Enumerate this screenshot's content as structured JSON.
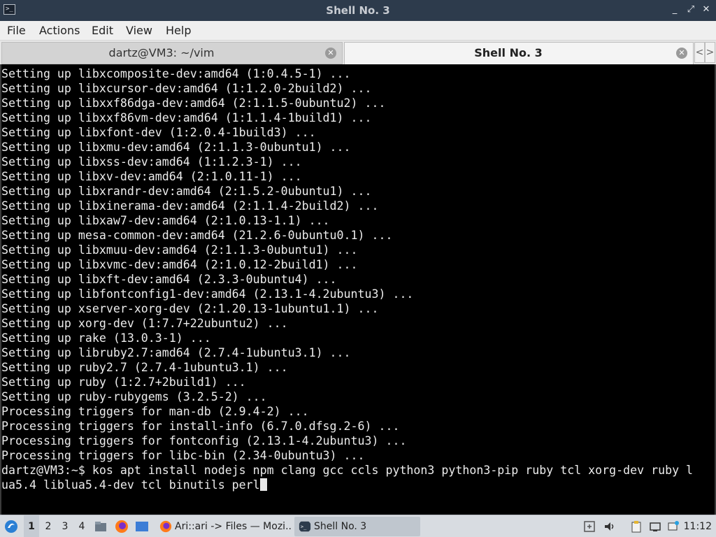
{
  "window": {
    "title": "Shell No. 3",
    "buttons": [
      "_",
      "⤢",
      "✕"
    ]
  },
  "menu": [
    "File",
    "Actions",
    "Edit",
    "View",
    "Help"
  ],
  "tabs": [
    {
      "label": "dartz@VM3: ~/vim",
      "active": false
    },
    {
      "label": "Shell No. 3",
      "active": true
    }
  ],
  "tab_nav": {
    "prev": "<",
    "next": ">"
  },
  "terminal": {
    "lines": [
      "Setting up libxcomposite-dev:amd64 (1:0.4.5-1) ...",
      "Setting up libxcursor-dev:amd64 (1:1.2.0-2build2) ...",
      "Setting up libxxf86dga-dev:amd64 (2:1.1.5-0ubuntu2) ...",
      "Setting up libxxf86vm-dev:amd64 (1:1.1.4-1build1) ...",
      "Setting up libxfont-dev (1:2.0.4-1build3) ...",
      "Setting up libxmu-dev:amd64 (2:1.1.3-0ubuntu1) ...",
      "Setting up libxss-dev:amd64 (1:1.2.3-1) ...",
      "Setting up libxv-dev:amd64 (2:1.0.11-1) ...",
      "Setting up libxrandr-dev:amd64 (2:1.5.2-0ubuntu1) ...",
      "Setting up libxinerama-dev:amd64 (2:1.1.4-2build2) ...",
      "Setting up libxaw7-dev:amd64 (2:1.0.13-1.1) ...",
      "Setting up mesa-common-dev:amd64 (21.2.6-0ubuntu0.1) ...",
      "Setting up libxmuu-dev:amd64 (2:1.1.3-0ubuntu1) ...",
      "Setting up libxvmc-dev:amd64 (2:1.0.12-2build1) ...",
      "Setting up libxft-dev:amd64 (2.3.3-0ubuntu4) ...",
      "Setting up libfontconfig1-dev:amd64 (2.13.1-4.2ubuntu3) ...",
      "Setting up xserver-xorg-dev (2:1.20.13-1ubuntu1.1) ...",
      "Setting up xorg-dev (1:7.7+22ubuntu2) ...",
      "Setting up rake (13.0.3-1) ...",
      "Setting up libruby2.7:amd64 (2.7.4-1ubuntu3.1) ...",
      "Setting up ruby2.7 (2.7.4-1ubuntu3.1) ...",
      "Setting up ruby (1:2.7+2build1) ...",
      "Setting up ruby-rubygems (3.2.5-2) ...",
      "Processing triggers for man-db (2.9.4-2) ...",
      "Processing triggers for install-info (6.7.0.dfsg.2-6) ...",
      "Processing triggers for fontconfig (2.13.1-4.2ubuntu3) ...",
      "Processing triggers for libc-bin (2.34-0ubuntu3) ...",
      "dartz@VM3:~$ kos apt install nodejs npm clang gcc ccls python3 python3-pip ruby tcl xorg-dev ruby l",
      "ua5.4 liblua5.4-dev tcl binutils perl"
    ]
  },
  "taskbar": {
    "desktops": [
      "1",
      "2",
      "3",
      "4"
    ],
    "tasks": [
      {
        "label": "Ari::ari -> Files — Mozi..."
      },
      {
        "label": "Shell No. 3"
      }
    ],
    "clock": "11:12"
  },
  "colors": {
    "titlebar": "#2d3b4c",
    "terminal_bg": "#000000",
    "terminal_fg": "#ececec",
    "taskbar": "#d8dce1"
  }
}
